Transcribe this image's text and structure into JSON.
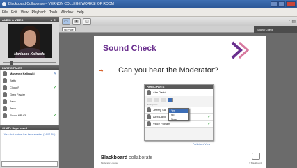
{
  "window": {
    "title": "Blackboard Collaborate – VERNON COLLEGE WORKSHOP ROOM"
  },
  "menu": [
    "File",
    "Edit",
    "View",
    "Playback",
    "Tools",
    "Window",
    "Help"
  ],
  "left": {
    "video_header": "AUDIO & VIDEO",
    "video_caption": "Marianne Kaliroski",
    "participants_header": "PARTICIPANTS",
    "participants": [
      {
        "name": "Marianne Kaliroski",
        "moderator": true,
        "mark": "edit"
      },
      {
        "name": "Betty",
        "moderator": false,
        "mark": ""
      },
      {
        "name": "CliqueR",
        "moderator": false,
        "mark": "check"
      },
      {
        "name": "Greg Fowler",
        "moderator": false,
        "mark": ""
      },
      {
        "name": "Jane",
        "moderator": false,
        "mark": ""
      },
      {
        "name": "Jerry",
        "moderator": false,
        "mark": ""
      },
      {
        "name": "Room HR #3",
        "moderator": false,
        "mark": "check"
      }
    ],
    "chat_header": "CHAT - Supervised",
    "chat_message": "Your chat partner has been enabled (14:07 PM)"
  },
  "toolbar": {
    "page_select": "No Page",
    "status_label": "Sound Check"
  },
  "slide": {
    "title": "Sound Check",
    "question": "Can you hear the Moderator?",
    "logo_brand": "Blackboard",
    "logo_product": "collaborate",
    "license": "Moderator License",
    "slide_ref": "© Blackboard",
    "participants_panel": {
      "header": "PARTICIPANTS",
      "moderator": "Abe David",
      "section_label": "Participants",
      "rows": [
        {
          "name": "Jeffery Sai",
          "mark": ""
        },
        {
          "name": "Alex David",
          "mark": "check"
        },
        {
          "name": "Vince Fulham",
          "mark": "check"
        }
      ],
      "dropdown": [
        "Yes",
        "No",
        "None"
      ],
      "caption": "Participant View"
    }
  },
  "colors": {
    "title_purple": "#6a2f8e",
    "check_green": "#35a33a",
    "accent_blue": "#3c6db6"
  }
}
